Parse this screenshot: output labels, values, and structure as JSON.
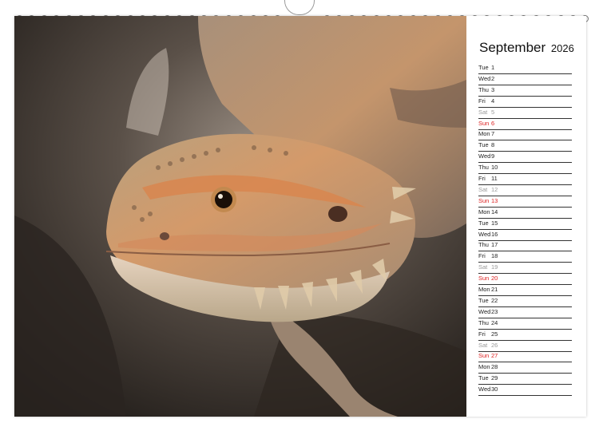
{
  "calendar": {
    "month": "September",
    "year": "2026",
    "days": [
      {
        "wd": "Tue",
        "d": "1",
        "type": "weekday"
      },
      {
        "wd": "Wed",
        "d": "2",
        "type": "weekday"
      },
      {
        "wd": "Thu",
        "d": "3",
        "type": "weekday"
      },
      {
        "wd": "Fri",
        "d": "4",
        "type": "weekday"
      },
      {
        "wd": "Sat",
        "d": "5",
        "type": "sat"
      },
      {
        "wd": "Sun",
        "d": "6",
        "type": "sun"
      },
      {
        "wd": "Mon",
        "d": "7",
        "type": "weekday"
      },
      {
        "wd": "Tue",
        "d": "8",
        "type": "weekday"
      },
      {
        "wd": "Wed",
        "d": "9",
        "type": "weekday"
      },
      {
        "wd": "Thu",
        "d": "10",
        "type": "weekday"
      },
      {
        "wd": "Fri",
        "d": "11",
        "type": "weekday"
      },
      {
        "wd": "Sat",
        "d": "12",
        "type": "sat"
      },
      {
        "wd": "Sun",
        "d": "13",
        "type": "sun"
      },
      {
        "wd": "Mon",
        "d": "14",
        "type": "weekday"
      },
      {
        "wd": "Tue",
        "d": "15",
        "type": "weekday"
      },
      {
        "wd": "Wed",
        "d": "16",
        "type": "weekday"
      },
      {
        "wd": "Thu",
        "d": "17",
        "type": "weekday"
      },
      {
        "wd": "Fri",
        "d": "18",
        "type": "weekday"
      },
      {
        "wd": "Sat",
        "d": "19",
        "type": "sat"
      },
      {
        "wd": "Sun",
        "d": "20",
        "type": "sun"
      },
      {
        "wd": "Mon",
        "d": "21",
        "type": "weekday"
      },
      {
        "wd": "Tue",
        "d": "22",
        "type": "weekday"
      },
      {
        "wd": "Wed",
        "d": "23",
        "type": "weekday"
      },
      {
        "wd": "Thu",
        "d": "24",
        "type": "weekday"
      },
      {
        "wd": "Fri",
        "d": "25",
        "type": "weekday"
      },
      {
        "wd": "Sat",
        "d": "26",
        "type": "sat"
      },
      {
        "wd": "Sun",
        "d": "27",
        "type": "sun"
      },
      {
        "wd": "Mon",
        "d": "28",
        "type": "weekday"
      },
      {
        "wd": "Tue",
        "d": "29",
        "type": "weekday"
      },
      {
        "wd": "Wed",
        "d": "30",
        "type": "weekday"
      }
    ]
  },
  "photo": {
    "subject": "bearded-dragon-lizard",
    "colors": {
      "background": "#3a332d",
      "scales_warm": "#c98a5a",
      "scales_light": "#d9cbb6",
      "eye": "#1a0f08"
    }
  },
  "colors": {
    "sunday": "#dd2222",
    "saturday": "#999999",
    "weekday": "#222222",
    "rule": "#333333"
  }
}
